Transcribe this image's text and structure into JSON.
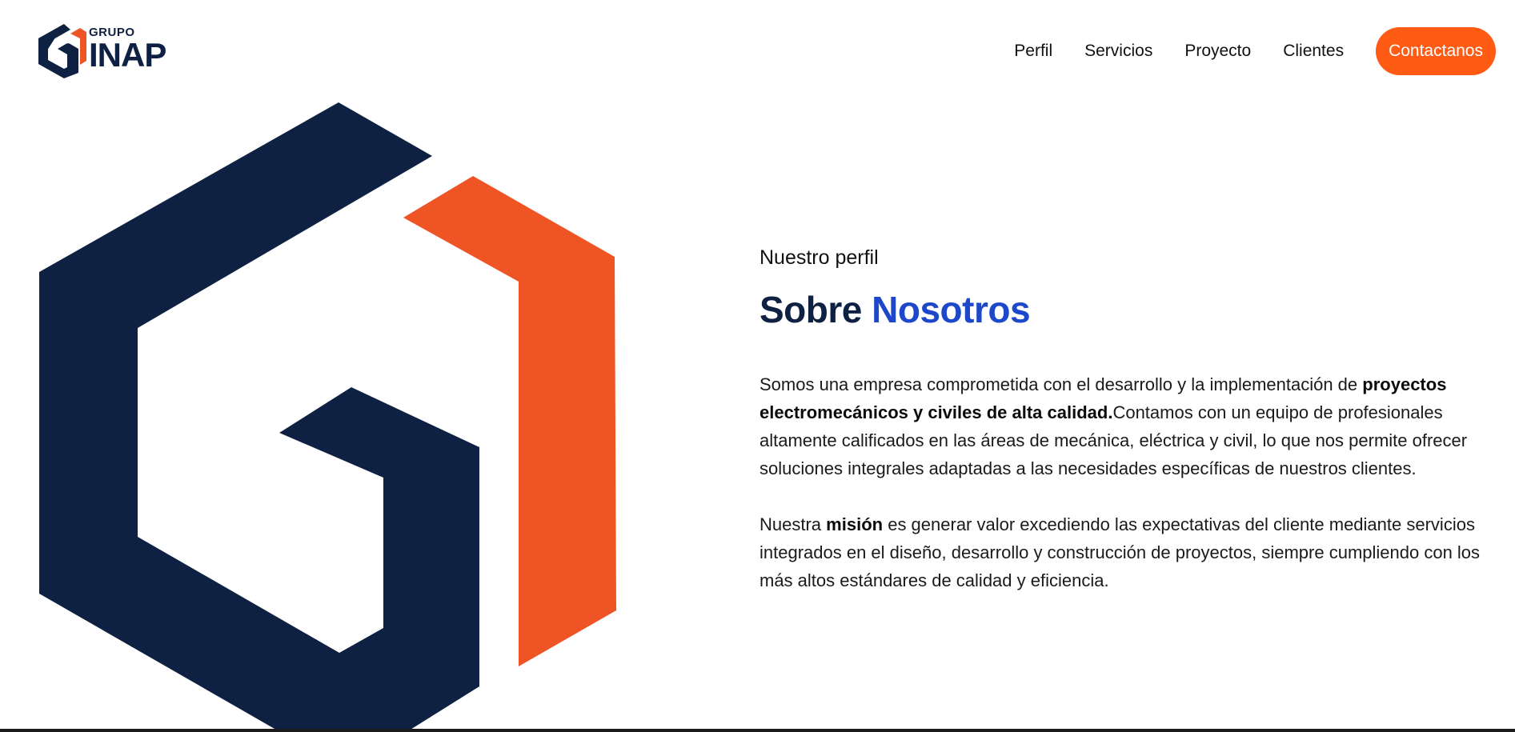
{
  "brand": {
    "small": "GRUPO",
    "big": "INAP",
    "colors": {
      "navy": "#0f2142",
      "orange": "#ef5425"
    }
  },
  "nav": {
    "items": [
      {
        "label": "Perfil"
      },
      {
        "label": "Servicios"
      },
      {
        "label": "Proyecto"
      },
      {
        "label": "Clientes"
      }
    ],
    "cta": "Contactanos",
    "cta_color": "#ff5b14"
  },
  "hero": {
    "graphic_icon": "grupo-inap-g-hexagon-logo",
    "colors": {
      "navy": "#0f2142",
      "orange": "#ef5425"
    }
  },
  "about": {
    "eyebrow": "Nuestro perfil",
    "title_part1": "Sobre",
    "title_part2": "Nosotros",
    "title_accent_color": "#1c48c9",
    "p1_intro": "Somos una empresa comprometida con el desarrollo y la implementación de",
    "p1_bold": "proyectos electromecánicos y civiles de alta calidad.",
    "p1_rest": "Contamos con un equipo de profesionales altamente calificados en las áreas de mecánica, eléctrica y civil, lo que nos permite ofrecer soluciones integrales adaptadas a las necesidades específicas de nuestros clientes.",
    "p2_intro": "Nuestra",
    "p2_bold": "misión",
    "p2_rest": "es generar valor excediendo las expectativas del cliente mediante servicios integrados en el diseño, desarrollo y construcción de proyectos, siempre cumpliendo con los más altos estándares de calidad y eficiencia."
  }
}
